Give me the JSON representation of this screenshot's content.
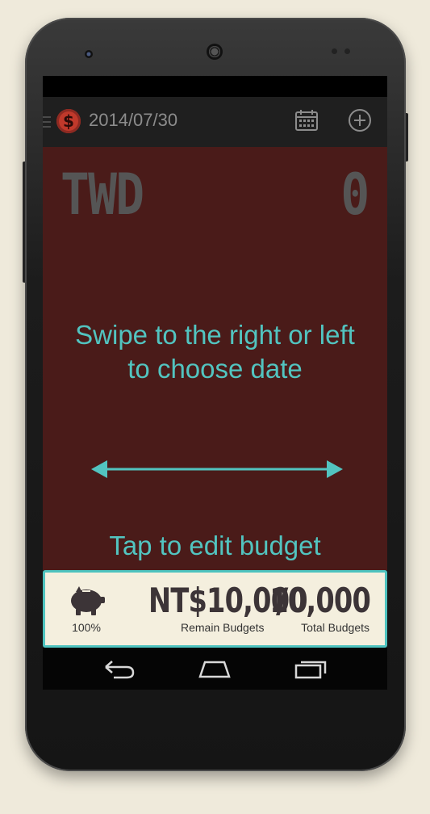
{
  "actionbar": {
    "app_icon_glyph": "$",
    "date": "2014/07/30",
    "icons": [
      "menu-icon",
      "app-logo-icon",
      "calendar-icon",
      "add-circle-icon"
    ]
  },
  "main": {
    "currency": "TWD",
    "amount": "0",
    "swipe_hint_line1": "Swipe to the right or left",
    "swipe_hint_line2": "to choose date",
    "tap_hint": "Tap to edit budget"
  },
  "budget": {
    "percent": "100%",
    "remain_value": "NT$10,000",
    "separator": "/",
    "total_value": "10,000",
    "remain_label": "Remain Budgets",
    "total_label": "Total Budgets"
  },
  "colors": {
    "main_bg": "#4a1b19",
    "accent": "#52c4c0",
    "budget_bg": "#f4efde",
    "action_bar": "#1f1f1f"
  },
  "navbar": {
    "icons": [
      "back-icon",
      "home-icon",
      "recents-icon"
    ]
  }
}
